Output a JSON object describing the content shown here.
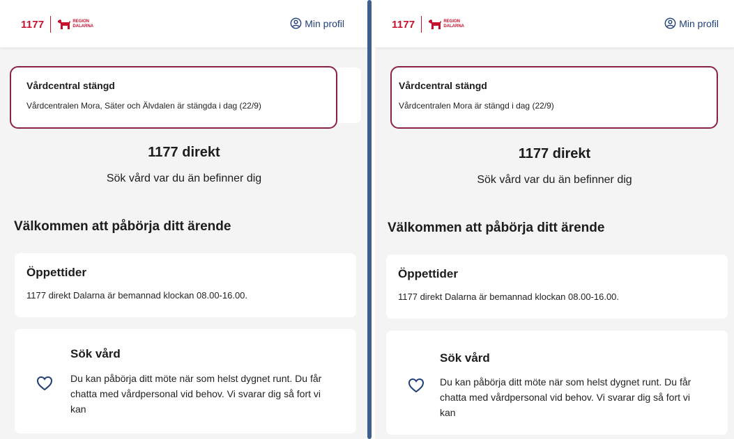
{
  "panels": [
    {
      "header": {
        "logo_main": "1177",
        "logo_region": "REGION\nDALARNA",
        "profile_label": "Min profil"
      },
      "alert": {
        "title": "Vårdcentral stängd",
        "text": "Vårdcentralen Mora, Säter och Älvdalen är stängda i dag (22/9)"
      },
      "direct": {
        "title": "1177 direkt",
        "subtitle": "Sök vård var du än befinner dig"
      },
      "welcome": "Välkommen att påbörja ditt ärende",
      "hours": {
        "title": "Öppettider",
        "text": "1177 direkt Dalarna är bemannad klockan 08.00-16.00."
      },
      "care": {
        "title": "Sök vård",
        "text": "Du kan påbörja ditt möte när som helst dygnet runt. Du får chatta med vårdpersonal vid behov. Vi svarar dig så fort vi kan"
      }
    },
    {
      "header": {
        "logo_main": "1177",
        "logo_region": "REGION\nDALARNA",
        "profile_label": "Min profil"
      },
      "alert": {
        "title": "Vårdcentral stängd",
        "text": "Vårdcentralen Mora är stängd i dag (22/9)"
      },
      "direct": {
        "title": "1177 direkt",
        "subtitle": "Sök vård var du än befinner dig"
      },
      "welcome": "Välkommen att påbörja ditt ärende",
      "hours": {
        "title": "Öppettider",
        "text": "1177 direkt Dalarna är bemannad klockan 08.00-16.00."
      },
      "care": {
        "title": "Sök vård",
        "text": "Du kan påbörja ditt möte när som helst dygnet runt. Du får chatta med vårdpersonal vid behov. Vi svarar dig så fort vi kan"
      }
    }
  ],
  "colors": {
    "brand_red": "#c8102e",
    "alert_border": "#8a2148",
    "link_blue": "#1f3f77",
    "divider": "#3f5f8f",
    "background": "#f4f4f4"
  }
}
